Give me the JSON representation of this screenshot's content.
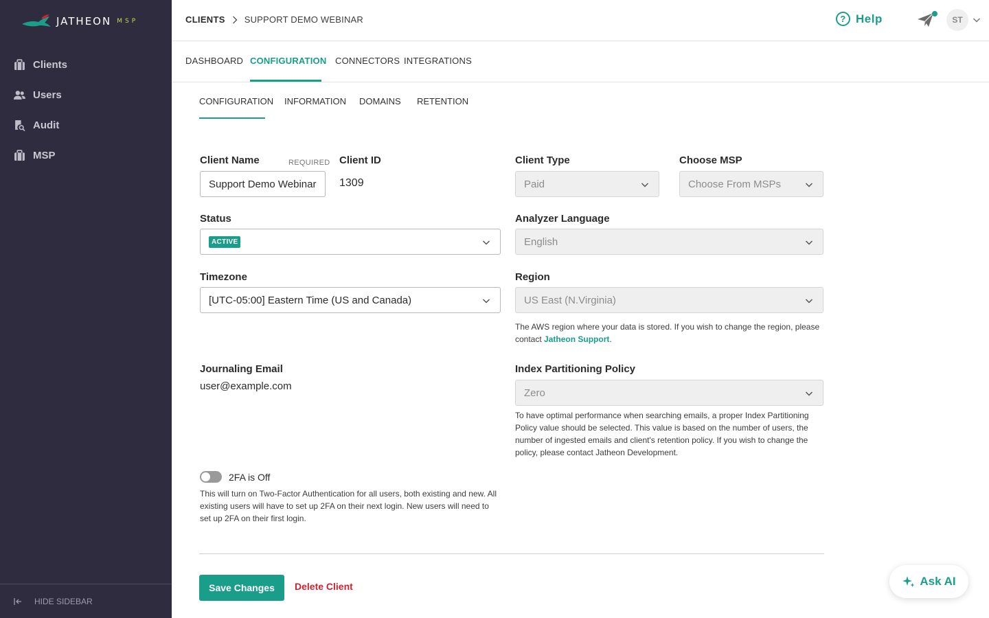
{
  "brand": {
    "name": "JATHEON",
    "sub": "MSP"
  },
  "sidebar": {
    "items": [
      {
        "label": "Clients",
        "icon": "briefcase-icon"
      },
      {
        "label": "Users",
        "icon": "users-icon"
      },
      {
        "label": "Audit",
        "icon": "audit-icon"
      },
      {
        "label": "MSP",
        "icon": "briefcase-icon"
      }
    ],
    "hide_label": "HIDE SIDEBAR"
  },
  "header": {
    "breadcrumb_root": "CLIENTS",
    "breadcrumb_current": "SUPPORT DEMO WEBINAR",
    "help_label": "Help",
    "avatar_initials": "ST"
  },
  "tabs": [
    "DASHBOARD",
    "CONFIGURATION",
    "CONNECTORS",
    "INTEGRATIONS"
  ],
  "subtabs": [
    "CONFIGURATION",
    "INFORMATION",
    "DOMAINS",
    "RETENTION"
  ],
  "form": {
    "client_name_label": "Client Name",
    "required_label": "REQUIRED",
    "client_name_value": "Support Demo Webinar",
    "client_id_label": "Client ID",
    "client_id_value": "1309",
    "client_type_label": "Client Type",
    "client_type_value": "Paid",
    "choose_msp_label": "Choose MSP",
    "choose_msp_placeholder": "Choose From MSPs",
    "status_label": "Status",
    "status_value": "ACTIVE",
    "analyzer_language_label": "Analyzer Language",
    "analyzer_language_value": "English",
    "timezone_label": "Timezone",
    "timezone_value": "[UTC-05:00] Eastern Time (US and Canada)",
    "region_label": "Region",
    "region_value": "US East (N.Virginia)",
    "region_note": "The AWS region where your data is stored. If you wish to change the region, please contact ",
    "region_note_link": "Jatheon Support",
    "region_note_end": ".",
    "journaling_email_label": "Journaling Email",
    "journaling_email_value": "user@example.com",
    "index_policy_label": "Index Partitioning Policy",
    "index_policy_value": "Zero",
    "index_policy_note": "To have optimal performance when searching emails, a proper Index Partitioning Policy value should be selected. This value is based on the number of users, the number of ingested emails and client's retention policy. If you wish to change the policy, please contact Jatheon Development.",
    "twofa_label": "2FA is Off",
    "twofa_note": "This will turn on Two-Factor Authentication for all users, both existing and new. All existing users will have to set up 2FA on their next login. New users will need to set up 2FA on their first login."
  },
  "actions": {
    "save_label": "Save Changes",
    "delete_label": "Delete Client",
    "ask_ai_label": "Ask AI"
  },
  "colors": {
    "accent": "#1a9e8a",
    "sidebar": "#2f2c40",
    "danger": "#d0222e"
  }
}
